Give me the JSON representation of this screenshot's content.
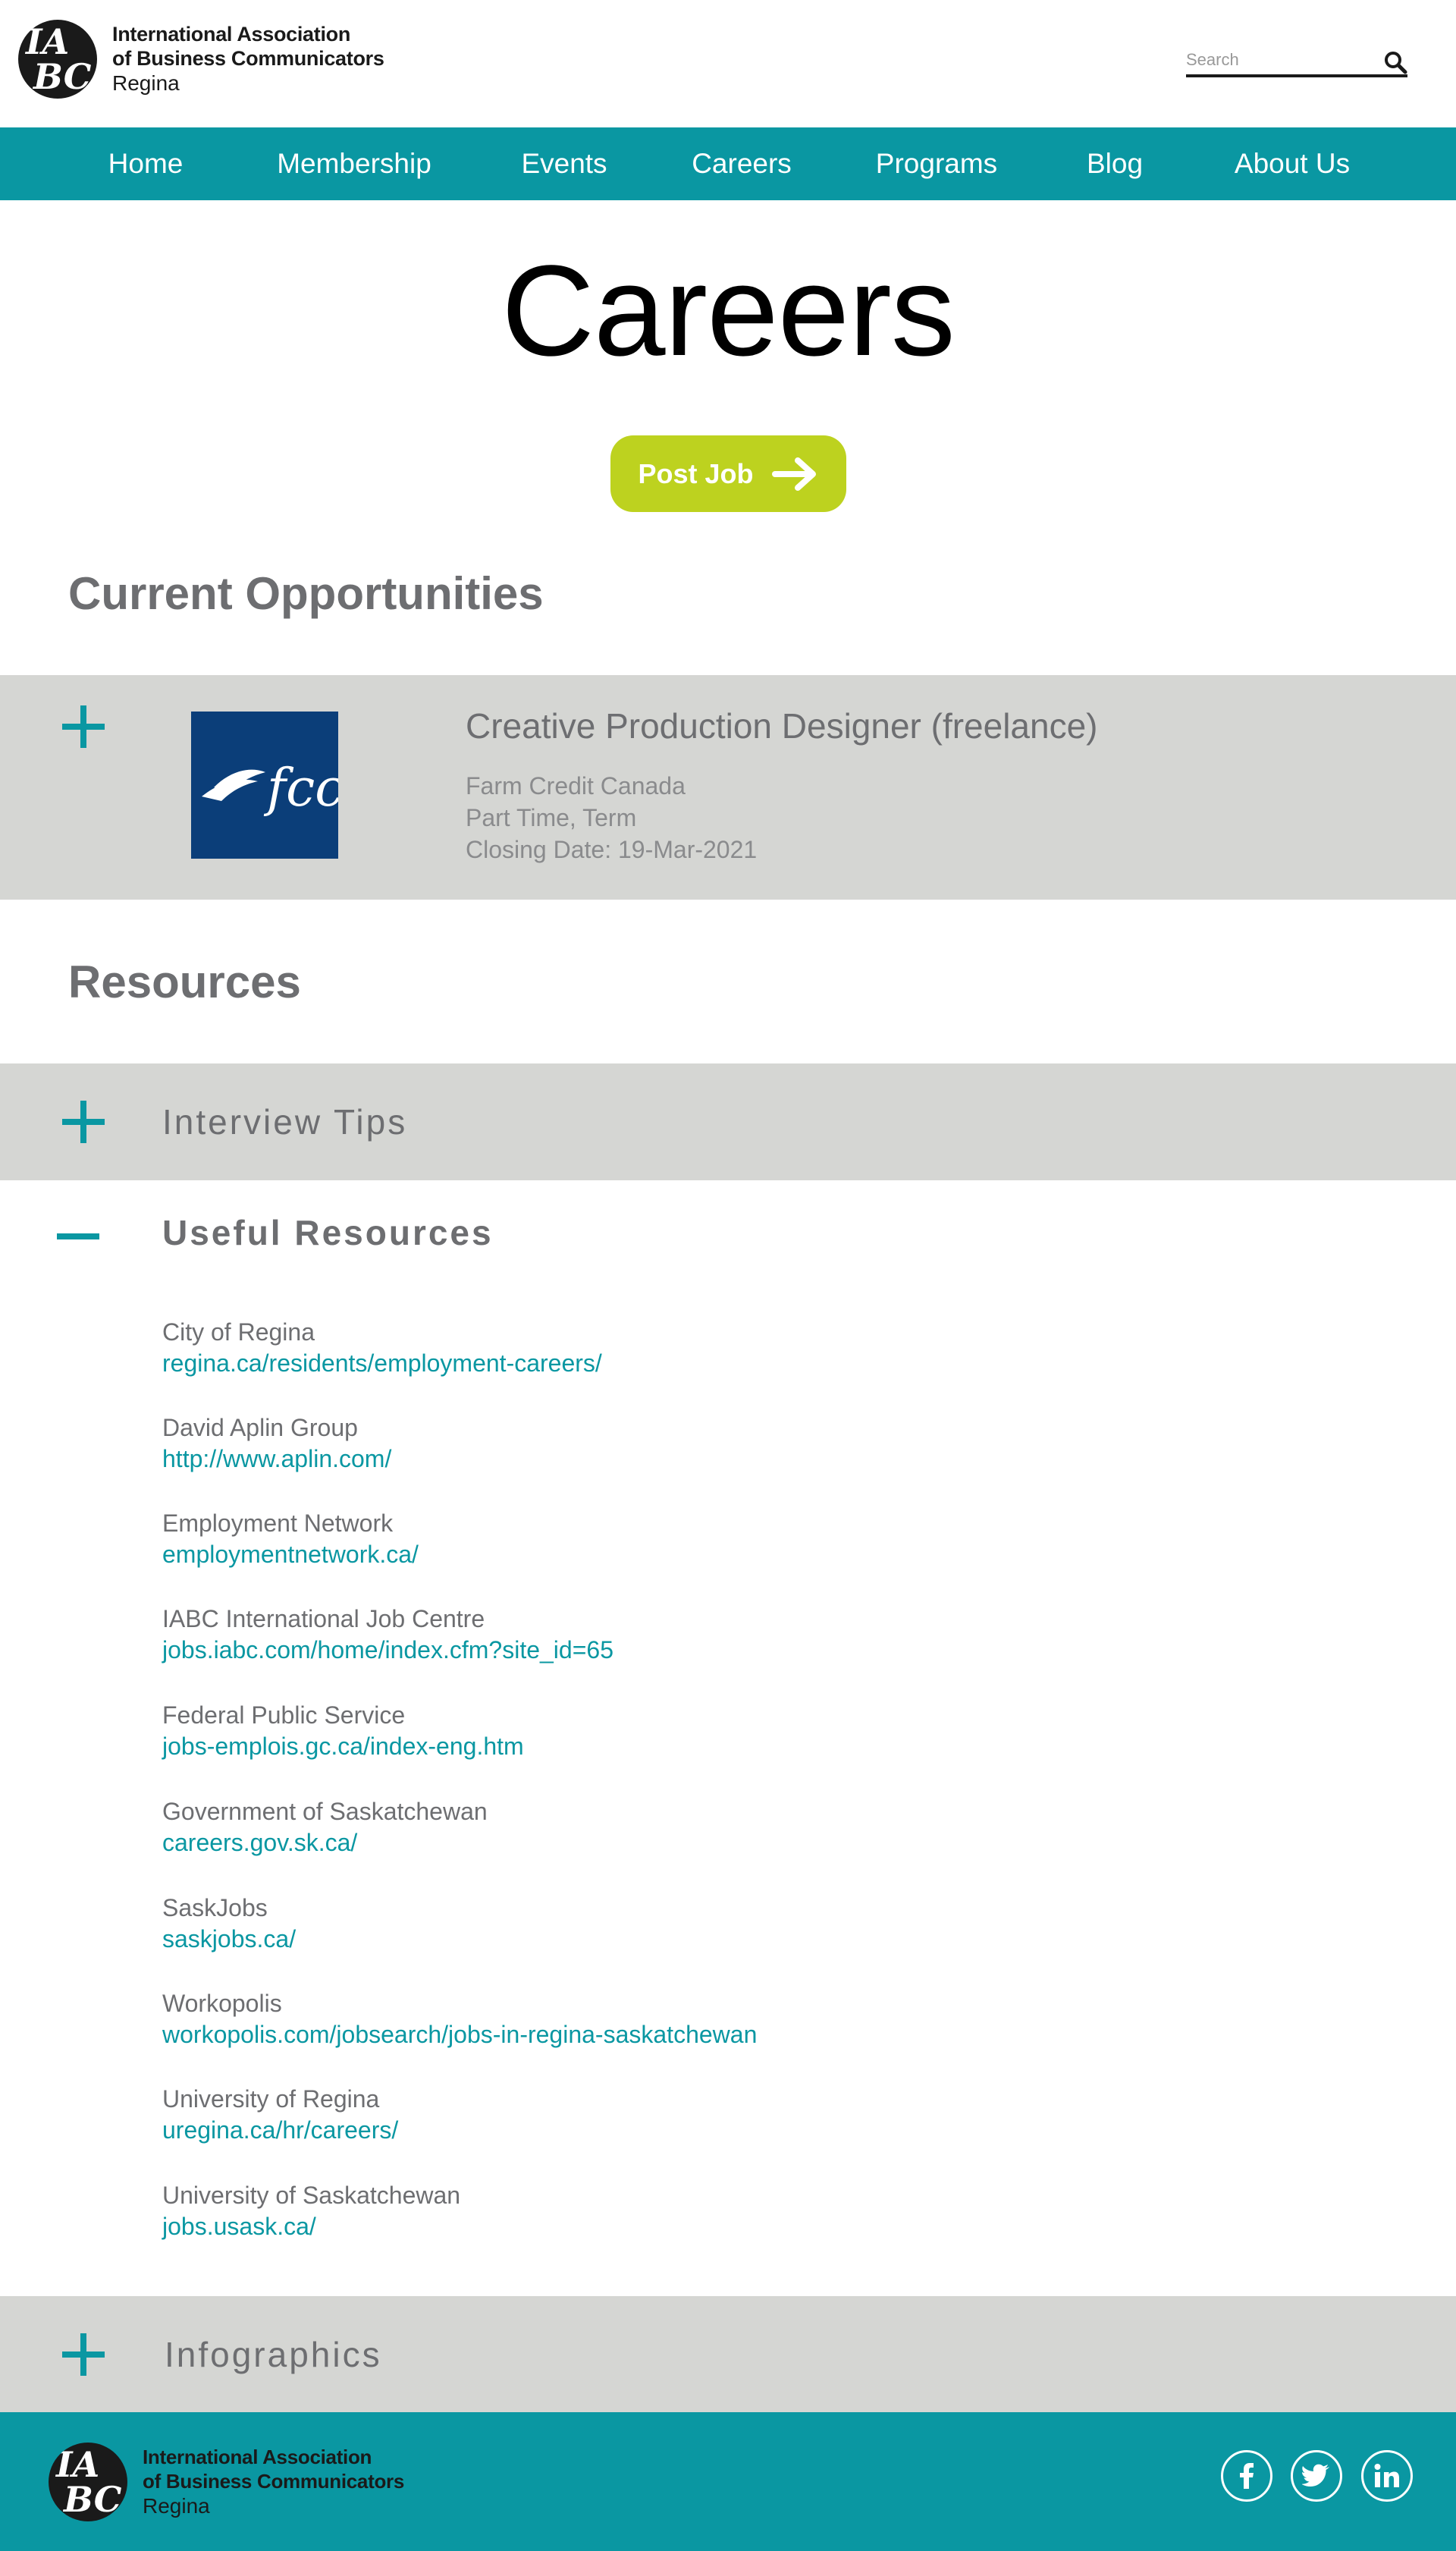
{
  "header": {
    "logo_letters": [
      "IA",
      "",
      "BC"
    ],
    "org_line1": "International Association",
    "org_line2": "of Business Communicators",
    "org_line3": "Regina",
    "search_placeholder": "Search",
    "search_icon": "search-icon"
  },
  "nav": {
    "items": [
      {
        "label": "Home"
      },
      {
        "label": "Membership"
      },
      {
        "label": "Events"
      },
      {
        "label": "Careers"
      },
      {
        "label": "Programs"
      },
      {
        "label": "Blog"
      },
      {
        "label": "About Us"
      }
    ]
  },
  "main": {
    "title": "Careers",
    "post_job_label": "Post Job",
    "opportunities_heading": "Current Opportunities",
    "job": {
      "title": "Creative Production Designer (freelance)",
      "company": "Farm Credit Canada",
      "type": "Part Time, Term",
      "closing": "Closing Date: 19-Mar-2021",
      "logo_text": "fcc"
    },
    "resources_heading": "Resources",
    "accordion": {
      "interview_tips": "Interview Tips",
      "useful_resources": "Useful Resources",
      "infographics": "Infographics"
    },
    "useful_resources": [
      {
        "name": "City of Regina",
        "link": "regina.ca/residents/employment-careers/"
      },
      {
        "name": "David Aplin Group",
        "link": "http://www.aplin.com/"
      },
      {
        "name": "Employment Network",
        "link": "employmentnetwork.ca/"
      },
      {
        "name": "IABC International Job Centre",
        "link": "jobs.iabc.com/home/index.cfm?site_id=65"
      },
      {
        "name": "Federal Public Service",
        "link": "jobs-emplois.gc.ca/index-eng.htm"
      },
      {
        "name": "Government of Saskatchewan",
        "link": "careers.gov.sk.ca/"
      },
      {
        "name": "SaskJobs",
        "link": "saskjobs.ca/"
      },
      {
        "name": "Workopolis",
        "link": "workopolis.com/jobsearch/jobs-in-regina-saskatchewan"
      },
      {
        "name": "University of Regina",
        "link": "uregina.ca/hr/careers/"
      },
      {
        "name": "University of Saskatchewan",
        "link": "jobs.usask.ca/"
      }
    ]
  },
  "footer": {
    "org_line1": "International Association",
    "org_line2": "of Business Communicators",
    "org_line3": "Regina",
    "social": [
      {
        "icon": "facebook-icon",
        "text": "f"
      },
      {
        "icon": "twitter-icon",
        "text": ""
      },
      {
        "icon": "linkedin-icon",
        "text": "in"
      }
    ]
  },
  "colors": {
    "teal": "#0a97a2",
    "lime": "#bdd21f",
    "gray_panel": "#d5d6d3",
    "fcc_navy": "#0b3e79",
    "text_gray": "#6d6e71"
  }
}
